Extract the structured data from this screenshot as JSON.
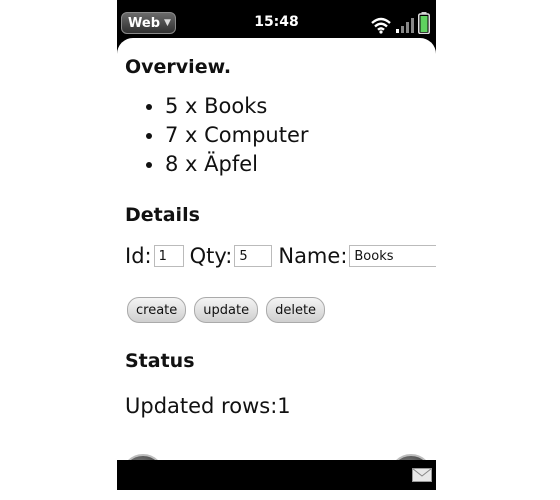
{
  "statusbar": {
    "app_menu": "Web",
    "time": "15:48",
    "icons": [
      "wifi-icon",
      "signal-bars-icon",
      "battery-icon"
    ]
  },
  "overview": {
    "heading": "Overview.",
    "items": [
      "5 x Books",
      "7 x Computer",
      "8 x Äpfel"
    ]
  },
  "details": {
    "heading": "Details",
    "id_label": "Id:",
    "id_value": "1",
    "qty_label": "Qty:",
    "qty_value": "5",
    "name_label": "Name:",
    "name_value": "Books",
    "buttons": {
      "create": "create",
      "update": "update",
      "delete": "delete"
    }
  },
  "status": {
    "heading": "Status",
    "text": "Updated rows:1"
  },
  "navigation": {
    "back_icon": "back-arrow-icon",
    "reload_icon": "reload-icon",
    "notification_icon": "mail-icon"
  },
  "colors": {
    "phone_chrome": "#000000",
    "battery": "#5fd35f",
    "content_bg": "#ffffff"
  }
}
